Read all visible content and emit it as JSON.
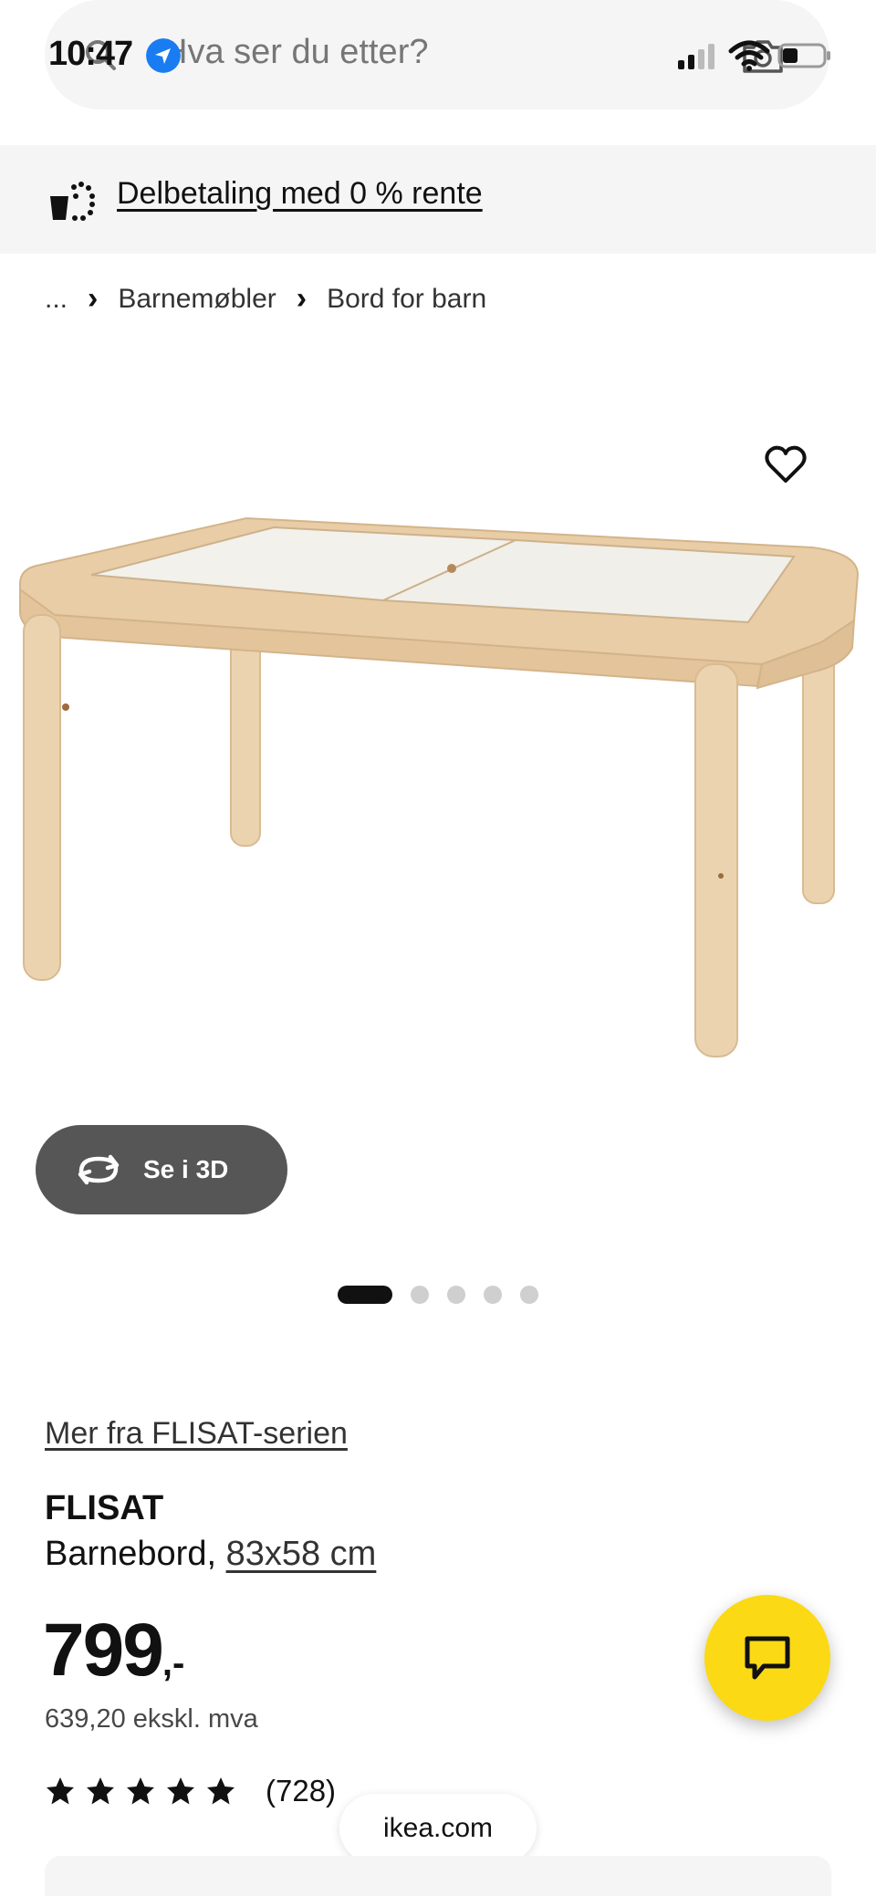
{
  "status_bar": {
    "time": "10:47"
  },
  "search": {
    "placeholder": "Hva ser du etter?"
  },
  "promo": {
    "link_text": "Delbetaling med 0 % rente"
  },
  "breadcrumb": {
    "items": [
      "...",
      "Barnemøbler",
      "Bord for barn"
    ]
  },
  "gallery": {
    "view_3d_label": "Se i 3D",
    "dot_count": 5,
    "active_index": 0
  },
  "product": {
    "series_link": "Mer fra FLISAT-serien",
    "name": "FLISAT",
    "type": "Barnebord,",
    "size": "83x58 cm",
    "price_main": "799",
    "price_suffix": ",-",
    "price_ex_vat": "639,20 ekskl. mva",
    "rating_stars": 5,
    "review_count": "(728)"
  },
  "browser": {
    "url": "ikea.com"
  },
  "colors": {
    "accent_yellow": "#fbd914",
    "button_gray": "#565656",
    "panel_gray": "#f5f5f5"
  }
}
